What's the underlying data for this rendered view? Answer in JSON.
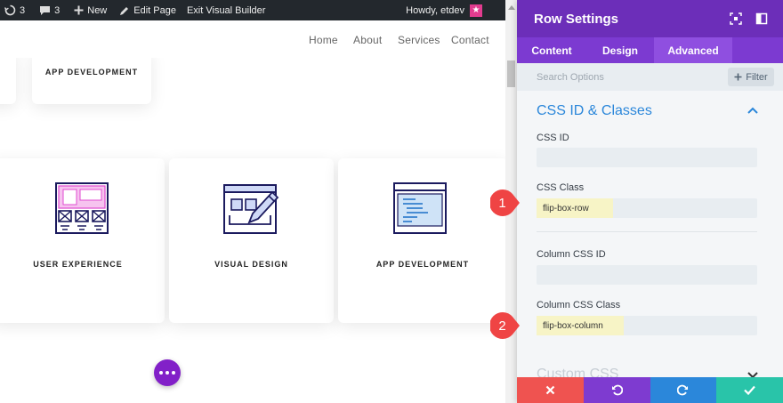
{
  "adminbar": {
    "updates_count": "3",
    "comments_count": "3",
    "new_label": "New",
    "edit_page_label": "Edit Page",
    "exit_label": "Exit Visual Builder",
    "greeting": "Howdy, etdev"
  },
  "nav": {
    "items": [
      "Home",
      "About",
      "Services",
      "Contact"
    ]
  },
  "cards": {
    "top_label": "APP DEVELOPMENT",
    "row": [
      "USER EXPERIENCE",
      "VISUAL DESIGN",
      "APP DEVELOPMENT"
    ]
  },
  "panel": {
    "title": "Row Settings",
    "tabs": [
      "Content",
      "Design",
      "Advanced"
    ],
    "active_tab": "Advanced",
    "search_placeholder": "Search Options",
    "filter_label": "Filter",
    "section_title": "CSS ID & Classes",
    "fields": {
      "css_id_label": "CSS ID",
      "css_id_value": "",
      "css_class_label": "CSS Class",
      "css_class_value": "flip-box-row",
      "col_css_id_label": "Column CSS ID",
      "col_css_id_value": "",
      "col_css_class_label": "Column CSS Class",
      "col_css_class_value": "flip-box-column"
    },
    "next_section_title": "Custom CSS"
  },
  "markers": [
    "1",
    "2"
  ],
  "colors": {
    "accent_purple": "#6c2eb9",
    "tab_bar": "#7c3ad1",
    "section_blue": "#2b87da",
    "marker_red": "#ef4444",
    "highlight_yellow": "#f7f4c6",
    "cancel": "#ef5350",
    "undo": "#7e3bd0",
    "redo": "#2b87da",
    "save": "#29c4a9"
  },
  "icons": [
    "updates-icon",
    "comments-icon",
    "plus-icon",
    "edit-icon",
    "avatar-icon",
    "fullscreen-icon",
    "split-view-icon",
    "close-icon",
    "undo-icon",
    "redo-icon",
    "check-icon"
  ]
}
